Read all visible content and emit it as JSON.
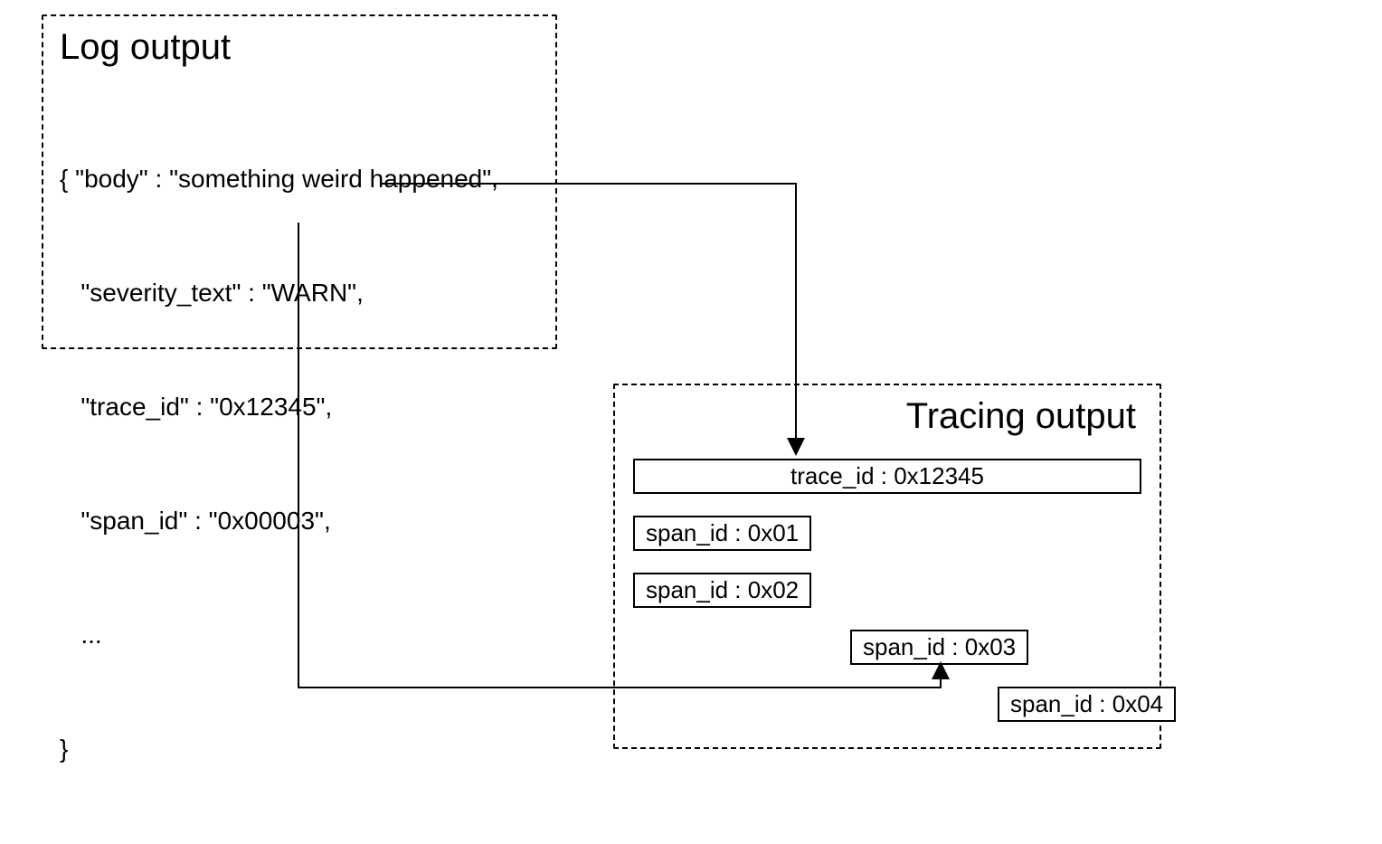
{
  "log_output": {
    "title": "Log output",
    "lines": [
      "{ \"body\" : \"something weird happened\",",
      "   \"severity_text\" : \"WARN\",",
      "   \"trace_id\" : \"0x12345\",",
      "   \"span_id\" : \"0x00003\",",
      "   ...",
      "}"
    ]
  },
  "tracing_output": {
    "title": "Tracing output",
    "trace": "trace_id : 0x12345",
    "spans": [
      "span_id : 0x01",
      "span_id : 0x02",
      "span_id : 0x03",
      "span_id : 0x04"
    ]
  }
}
